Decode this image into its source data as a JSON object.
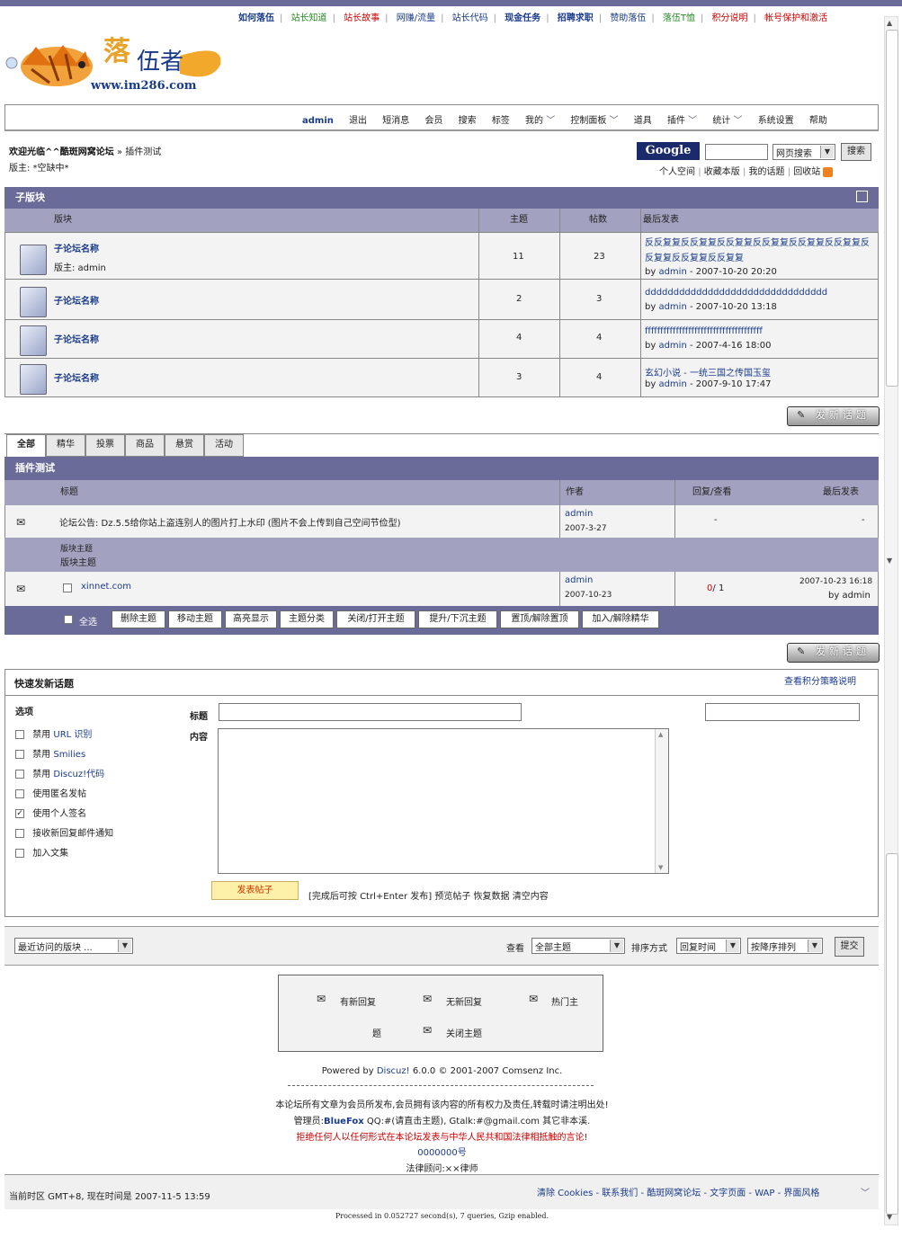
{
  "top_links": [
    "如何落伍",
    "站长知道",
    "站长故事",
    "网赚/流量",
    "站长代码",
    "现金任务",
    "招聘求职",
    "赞助落伍",
    "落伍T恤",
    "积分说明",
    "帐号保护和激活"
  ],
  "logo": {
    "cn": "伍者",
    "url": "www.im286.com"
  },
  "nav": {
    "user": "admin",
    "items": [
      "退出",
      "短消息",
      "会员",
      "搜索",
      "标签",
      "我的",
      "控制面板",
      "道具",
      "插件",
      "统计",
      "系统设置",
      "帮助"
    ]
  },
  "breadcrumb": {
    "welcome": "欢迎光临^^酷斑网窝论坛",
    "current": "» 插件测试",
    "moderator": "版主: *空缺中*"
  },
  "search": {
    "brand": "Google",
    "type": "网页搜索",
    "button": "搜索"
  },
  "user_links": [
    "个人空间",
    "收藏本版",
    "我的话题",
    "回收站"
  ],
  "subforum": {
    "title": "子版块",
    "headers": {
      "forum": "版块",
      "topics": "主题",
      "posts": "帖数",
      "last": "最后发表"
    },
    "rows": [
      {
        "name": "子论坛名称",
        "mod": "版主: admin",
        "topics": "11",
        "posts": "23",
        "last_title": "反反复复反反复复反反复复反反复复反反复复反反复复反反复复反反复复反反复复",
        "by": "by",
        "author": "admin",
        "time": "2007-10-20 20:20"
      },
      {
        "name": "子论坛名称",
        "mod": "",
        "topics": "2",
        "posts": "3",
        "last_title": "dddddddddddddddddddddddddddddddd",
        "by": "by",
        "author": "admin",
        "time": "2007-10-20 13:18"
      },
      {
        "name": "子论坛名称",
        "mod": "",
        "topics": "4",
        "posts": "4",
        "last_title": "ffffffffffffffffffffffffffffffffffffff",
        "by": "by",
        "author": "admin",
        "time": "2007-4-16 18:00"
      },
      {
        "name": "子论坛名称",
        "mod": "",
        "topics": "3",
        "posts": "4",
        "last_title": "玄幻小说 - 一统三国之传国玉玺",
        "by": "by",
        "author": "admin",
        "time": "2007-9-10 17:47"
      }
    ]
  },
  "new_topic_label": "发新话题",
  "tabs": [
    "全部",
    "精华",
    "投票",
    "商品",
    "悬赏",
    "活动"
  ],
  "topics": {
    "title": "插件测试",
    "headers": {
      "title": "标题",
      "author": "作者",
      "replies": "回复/查看",
      "last": "最后发表"
    },
    "notice": {
      "title": "论坛公告: Dz.5.5给你站上盗连别人的图片打上水印 (图片不会上传到自己空间节俭型)",
      "author": "admin",
      "date": "2007-3-27",
      "replies": "-",
      "last": "-"
    },
    "section_label_1": "版块主题",
    "section_label_2": "版块主题",
    "thread": {
      "title": "xinnet.com",
      "author": "admin",
      "date": "2007-10-23",
      "reply_count": "0",
      "view_sep": "/",
      "view_count": "1",
      "last_time": "2007-10-23 16:18",
      "last_by": "by admin"
    },
    "select_all": "全选",
    "ops": [
      "删除主题",
      "移动主题",
      "高亮显示",
      "主题分类",
      "关闭/打开主题",
      "提升/下沉主题",
      "置顶/解除置顶",
      "加入/解除精华"
    ]
  },
  "quickpost": {
    "title": "快速发新话题",
    "policy": "查看积分策略说明",
    "options_label": "选项",
    "subject_label": "标题",
    "content_label": "内容",
    "options": [
      {
        "prefix": "禁用",
        "text": "URL 识别",
        "checked": false
      },
      {
        "prefix": "禁用",
        "text": "Smilies",
        "checked": false
      },
      {
        "prefix": "禁用",
        "text": "Discuz!代码",
        "checked": false
      },
      {
        "prefix": "",
        "text": "使用匿名发帖",
        "checked": false
      },
      {
        "prefix": "",
        "text": "使用个人签名",
        "checked": true
      },
      {
        "prefix": "",
        "text": "接收新回复邮件通知",
        "checked": false
      },
      {
        "prefix": "",
        "text": "加入文集",
        "checked": false
      }
    ],
    "submit": "发表帖子",
    "hint": "[完成后可按 Ctrl+Enter 发布]  预览帖子  恢复数据  清空内容"
  },
  "filter": {
    "recent": "最近访问的版块 ...",
    "view_label": "查看",
    "view_value": "全部主题",
    "sort_label": "排序方式",
    "sort_value": "回复时间",
    "order_value": "按降序排列",
    "submit": "提交"
  },
  "legend": {
    "new_reply": "有新回复",
    "no_reply": "无新回复",
    "hot": "热门主",
    "hot_cont": "题",
    "closed": "关闭主题"
  },
  "footer": {
    "powered": "Powered by",
    "product": "Discuz!",
    "version": "6.0.0",
    "copyright": "© 2001-2007 Comsenz Inc.",
    "line1": "本论坛所有文章为会员所发布,会员拥有该内容的所有权力及责任,转载时请注明出处!",
    "line2_a": "管理员:",
    "line2_admin": "BlueFox",
    "line2_b": " QQ:#(请直击主题), Gtalk:#@gmail.com 其它非本溪.",
    "line3": "拒绝任何人以任何形式在本论坛发表与中华人民共和国法律相抵触的言论!",
    "icp": "0000000号",
    "lawyer": "法律顾问:××律师",
    "timezone": "当前时区 GMT+8, 现在时间是 2007-11-5 13:59",
    "links": "清除 Cookies - 联系我们 - 酷斑网窝论坛 - 文字页面 - WAP - 界面风格",
    "processed": "Processed in 0.052727 second(s), 7 queries, Gzip enabled."
  },
  "colors": {
    "bar": "#6b6b9a",
    "colhead": "#a2a2c0",
    "link_red": "#cc0000",
    "link_green": "#2a8a2a"
  }
}
